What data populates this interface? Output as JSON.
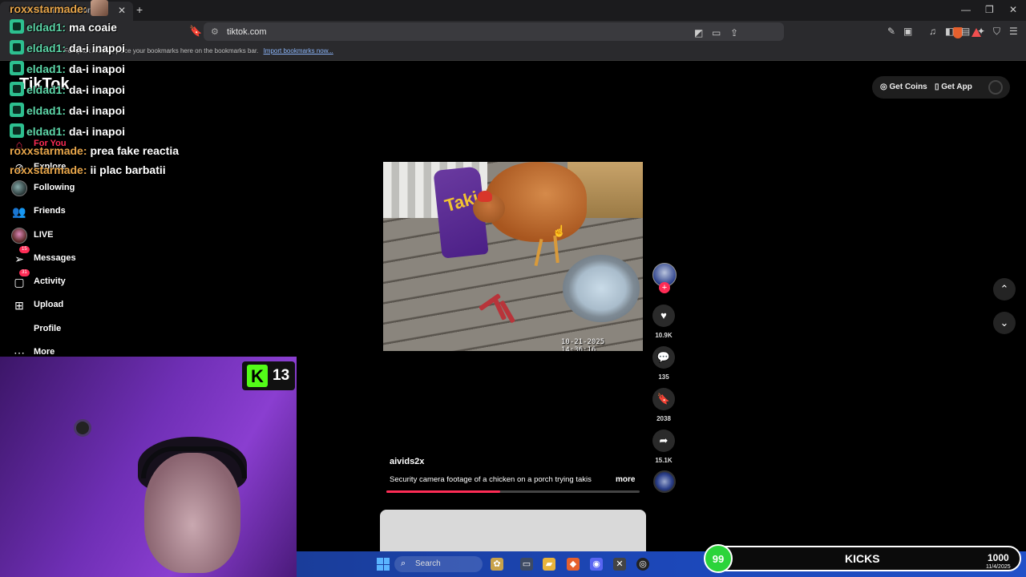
{
  "browser": {
    "tab_title": "TikTok - Make Your Day",
    "url": "tiktok.com",
    "bookmarks_hint": "For quick access, place your bookmarks here on the bookmarks bar.",
    "import_bookmarks": "Import bookmarks now..."
  },
  "chat": [
    {
      "user": "roxxstarmade:",
      "message": "",
      "style": "b",
      "emote": true
    },
    {
      "user": "eldad1:",
      "message": "ma coaie",
      "style": "a"
    },
    {
      "user": "eldad1:",
      "message": "da-i inapoi",
      "style": "a"
    },
    {
      "user": "eldad1:",
      "message": "da-i inapoi",
      "style": "a"
    },
    {
      "user": "eldad1:",
      "message": "da-i inapoi",
      "style": "a"
    },
    {
      "user": "eldad1:",
      "message": "da-i inapoi",
      "style": "a"
    },
    {
      "user": "eldad1:",
      "message": "da-i inapoi",
      "style": "a"
    },
    {
      "user": "roxxstarmade:",
      "message": "prea fake reactia",
      "style": "b"
    },
    {
      "user": "roxxstarmade:",
      "message": "ii plac barbatii",
      "style": "b"
    }
  ],
  "sidebar": {
    "logo": "TikTok",
    "items": [
      {
        "label": "For You",
        "icon": "home-icon",
        "badge": ""
      },
      {
        "label": "Explore",
        "icon": "compass-icon",
        "badge": ""
      },
      {
        "label": "Following",
        "icon": "avatar",
        "badge": ""
      },
      {
        "label": "Friends",
        "icon": "friends-icon",
        "badge": ""
      },
      {
        "label": "LIVE",
        "icon": "live-avatar",
        "badge": ""
      },
      {
        "label": "Messages",
        "icon": "send-icon",
        "badge": "15"
      },
      {
        "label": "Activity",
        "icon": "inbox-icon",
        "badge": "31"
      },
      {
        "label": "Upload",
        "icon": "plus-square-icon",
        "badge": ""
      },
      {
        "label": "Profile",
        "icon": "",
        "badge": ""
      },
      {
        "label": "More",
        "icon": "more-icon",
        "badge": ""
      }
    ]
  },
  "header": {
    "get_coins": "Get Coins",
    "get_app": "Get App"
  },
  "video": {
    "timestamp": "10-21-2025 14:36:16",
    "author": "aivids2x",
    "description": "Security camera footage of a chicken on a porch trying takis",
    "more": "more",
    "bag_label": "Takis",
    "progress": 0.45
  },
  "actions": {
    "likes": "10.9K",
    "comments": "135",
    "saves": "2038",
    "shares": "15.1K"
  },
  "stream": {
    "kick_viewers": "13",
    "kicks_label": "KICKS",
    "kicks_current": "99",
    "kicks_goal": "1000"
  },
  "taskbar": {
    "search_label": "Search",
    "date": "11/4/2025"
  },
  "colors": {
    "tiktok_red": "#fe2c55",
    "kick_green": "#53fc18",
    "chat_user_a": "#5dd6a8",
    "chat_user_b": "#e8a64a"
  }
}
